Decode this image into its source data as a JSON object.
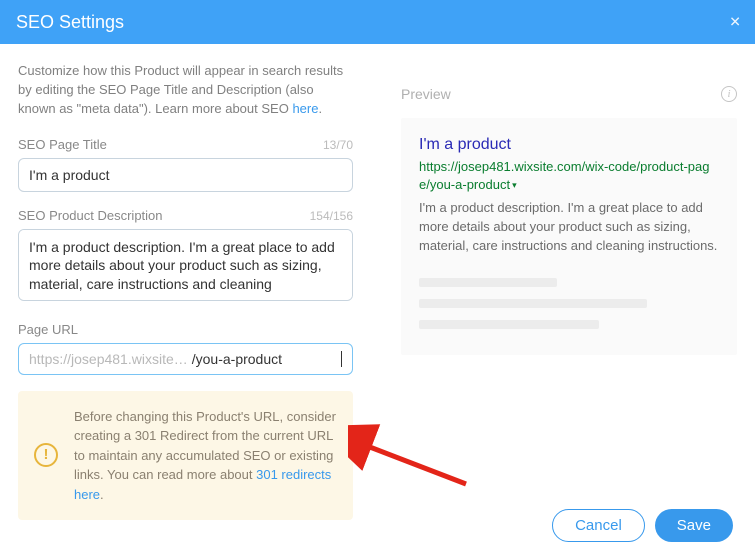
{
  "header": {
    "title": "SEO Settings",
    "close_glyph": "✕"
  },
  "intro": {
    "text_before": "Customize how this Product will appear in search results by editing the SEO Page Title and Description (also known as \"meta data\"). Learn more about SEO ",
    "link_text": "here",
    "text_after": "."
  },
  "fields": {
    "title": {
      "label": "SEO Page Title",
      "count": "13/70",
      "value": "I'm a product"
    },
    "description": {
      "label": "SEO Product Description",
      "count": "154/156",
      "value": "I'm a product description. I'm a great place to add more details about your product such as sizing, material, care instructions and cleaning"
    },
    "url": {
      "label": "Page URL",
      "prefix": "https://josep481.wixsite…",
      "slug": "/you-a-product"
    }
  },
  "warning": {
    "icon_glyph": "!",
    "text_before": "Before changing this Product's URL, consider creating a 301 Redirect from the current URL to maintain any accumulated SEO or existing links. You can read more about ",
    "link_text": "301 redirects here",
    "text_after": "."
  },
  "preview": {
    "label": "Preview",
    "info_glyph": "i",
    "title": "I'm a product",
    "url": "https://josep481.wixsite.com/wix-code/product-page/you-a-product",
    "dropdown_glyph": "▾",
    "description": "I'm a product description. I'm a great place to add more details about your product such as sizing, material, care instructions and cleaning instructions."
  },
  "footer": {
    "cancel": "Cancel",
    "save": "Save"
  }
}
